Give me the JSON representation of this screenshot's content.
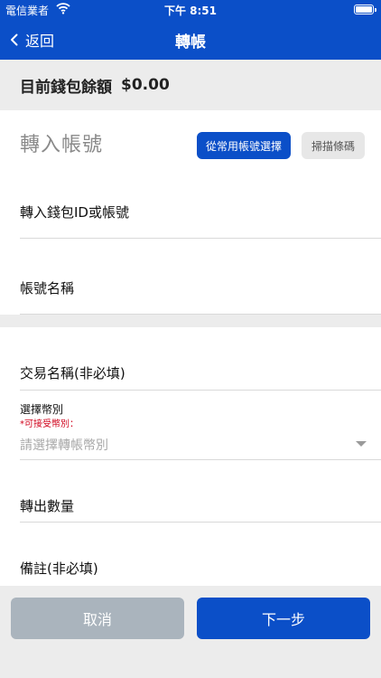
{
  "status_bar": {
    "carrier": "電信業者",
    "time": "下午 8:51"
  },
  "nav": {
    "back_label": "返回",
    "title": "轉帳"
  },
  "balance": {
    "label": "目前錢包餘額",
    "amount": "$0.00"
  },
  "transfer_account": {
    "section_title": "轉入帳號",
    "common_button": "從常用帳號選擇",
    "scan_button": "掃描條碼",
    "wallet_id_label": "轉入錢包ID或帳號",
    "account_name_label": "帳號名稱"
  },
  "transaction": {
    "name_label": "交易名稱(非必填)",
    "currency_label": "選擇幣別",
    "currency_hint": "*可接受幣別：",
    "currency_placeholder": "請選擇轉帳幣別",
    "amount_label": "轉出數量",
    "note_label": "備註(非必填)"
  },
  "footer": {
    "cancel_label": "取消",
    "next_label": "下一步"
  },
  "colors": {
    "primary": "#0b4fc8",
    "cancel": "#aab4bd",
    "hint": "#d0021b"
  },
  "icons": {
    "back": "chevron-left-icon",
    "wifi": "wifi-icon",
    "battery": "battery-icon",
    "dropdown": "caret-down-icon"
  }
}
